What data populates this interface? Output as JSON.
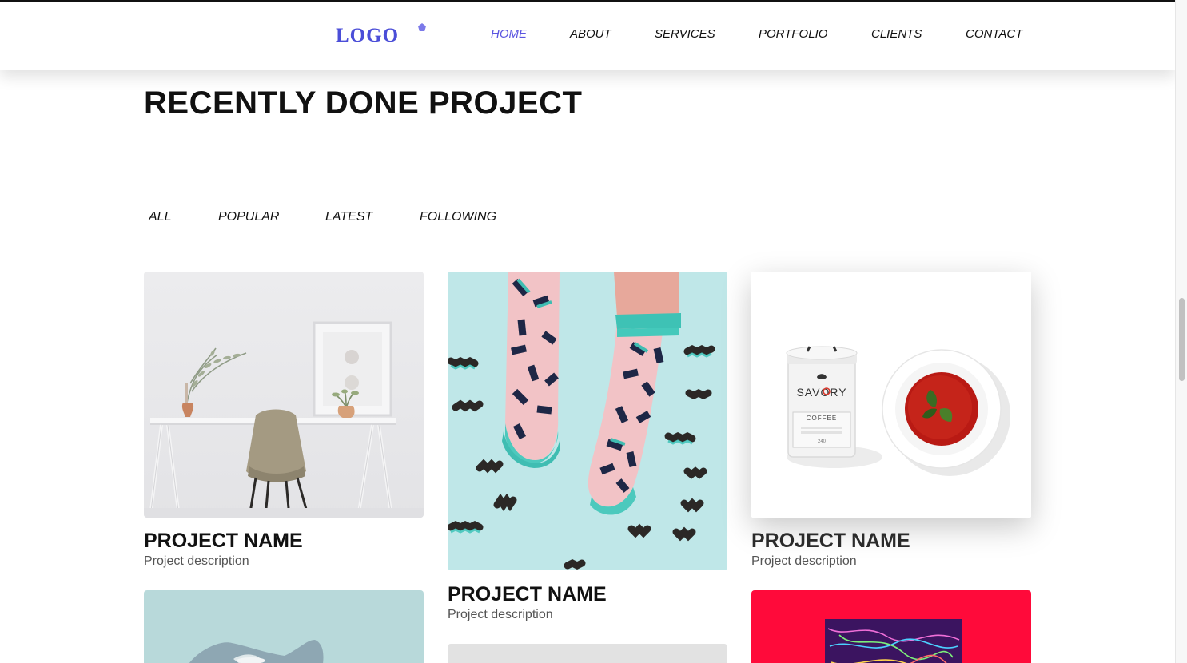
{
  "header": {
    "logo_text": "LOGO",
    "nav": [
      {
        "label": "HOME",
        "active": true
      },
      {
        "label": "ABOUT"
      },
      {
        "label": "SERVICES"
      },
      {
        "label": "PORTFOLIO"
      },
      {
        "label": "CLIENTS"
      },
      {
        "label": "CONTACT"
      }
    ]
  },
  "section": {
    "title": "RECENTLY DONE PROJECT",
    "filters": [
      "ALL",
      "POPULAR",
      "LATEST",
      "FOLLOWING"
    ]
  },
  "projects": [
    {
      "name": "PROJECT NAME",
      "description": "Project description",
      "image": "desk-chair-photo"
    },
    {
      "name": "PROJECT NAME",
      "description": "Project description",
      "image": "patterned-socks-photo"
    },
    {
      "name": "PROJECT NAME",
      "description": "Project description",
      "image": "savory-coffee-soup-photo"
    },
    {
      "name": "",
      "description": "",
      "image": "sneaker-photo"
    },
    {
      "name": "",
      "description": "",
      "image": "grey-photo"
    },
    {
      "name": "",
      "description": "",
      "image": "red-abstract-art-photo"
    }
  ],
  "savory_label": {
    "brand": "SAVORY",
    "product": "COFFEE",
    "weight": "240"
  },
  "colors": {
    "accent": "#5b55e0",
    "logo": "#4b4ed8",
    "text": "#111111",
    "muted": "#555555",
    "red_card": "#ff0a3a",
    "teal_card": "#b8d9da",
    "socks_bg": "#bfe7e8"
  }
}
